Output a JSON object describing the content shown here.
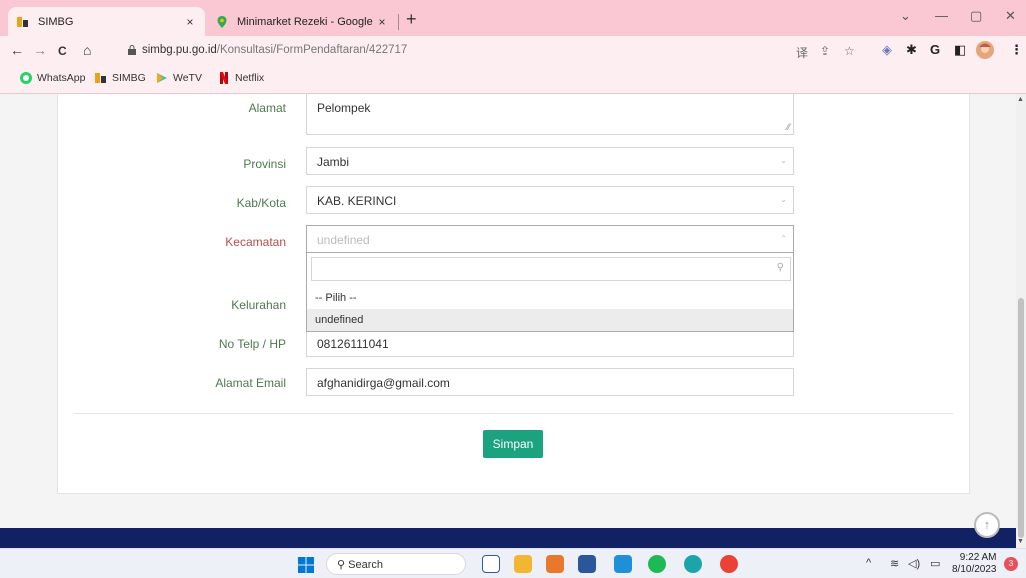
{
  "browser": {
    "tabs": [
      {
        "title": "SIMBG",
        "active": true
      },
      {
        "title": "Minimarket Rezeki - Google Ma",
        "active": false
      }
    ],
    "close_glyph": "×",
    "new_tab_glyph": "+",
    "window_controls": {
      "minimize": "—",
      "maximize": "▢",
      "close": "✕",
      "tab_search": "⌄"
    },
    "url": {
      "host": "simbg.pu.go.id",
      "path": "/Konsultasi/FormPendaftaran/422717"
    },
    "nav_glyphs": {
      "back": "←",
      "forward": "→",
      "reload": "C",
      "home": "⌂"
    },
    "omnibox_icons": {
      "translate": "译",
      "share": "⇪",
      "bookmark": "☆"
    },
    "extension_glyphs": {
      "shield": "◈",
      "puzzle": "✱",
      "g": "G",
      "sidepanel": "◧",
      "menu": "⋮"
    },
    "bookmarks": [
      "WhatsApp",
      "SIMBG",
      "WeTV",
      "Netflix"
    ]
  },
  "form": {
    "fields": [
      {
        "label": "Alamat",
        "value": "Pelompek"
      },
      {
        "label": "Provinsi",
        "value": "Jambi"
      },
      {
        "label": "Kab/Kota",
        "value": "KAB. KERINCI"
      },
      {
        "label": "Kecamatan",
        "value": "undefined"
      },
      {
        "label": "Kelurahan",
        "value": ""
      },
      {
        "label": "No Telp / HP",
        "value": "08126111041"
      },
      {
        "label": "Alamat Email",
        "value": "afghanidirga@gmail.com"
      }
    ],
    "dropdown_options": [
      "-- Pilih --",
      "undefined"
    ],
    "highlighted_option": "undefined",
    "submit_label": "Simpan",
    "resize_glyph": "⁄⁄",
    "caret_down": "⌄",
    "caret_up": "⌃",
    "search_glyph": "⚲",
    "back_to_top_glyph": "↑"
  },
  "taskbar": {
    "search_label": "Search",
    "time": "9:22 AM",
    "date": "8/10/2023",
    "notification_count": "3",
    "tray": {
      "chevron": "^",
      "wifi": "≋",
      "volume": "◁)",
      "battery": "▭"
    }
  },
  "colors": {
    "tabstrip": "#f9c8d2",
    "label_green": "#4d7a4d",
    "label_red": "#b0504a",
    "button": "#1aa37e",
    "footer": "#122064"
  }
}
